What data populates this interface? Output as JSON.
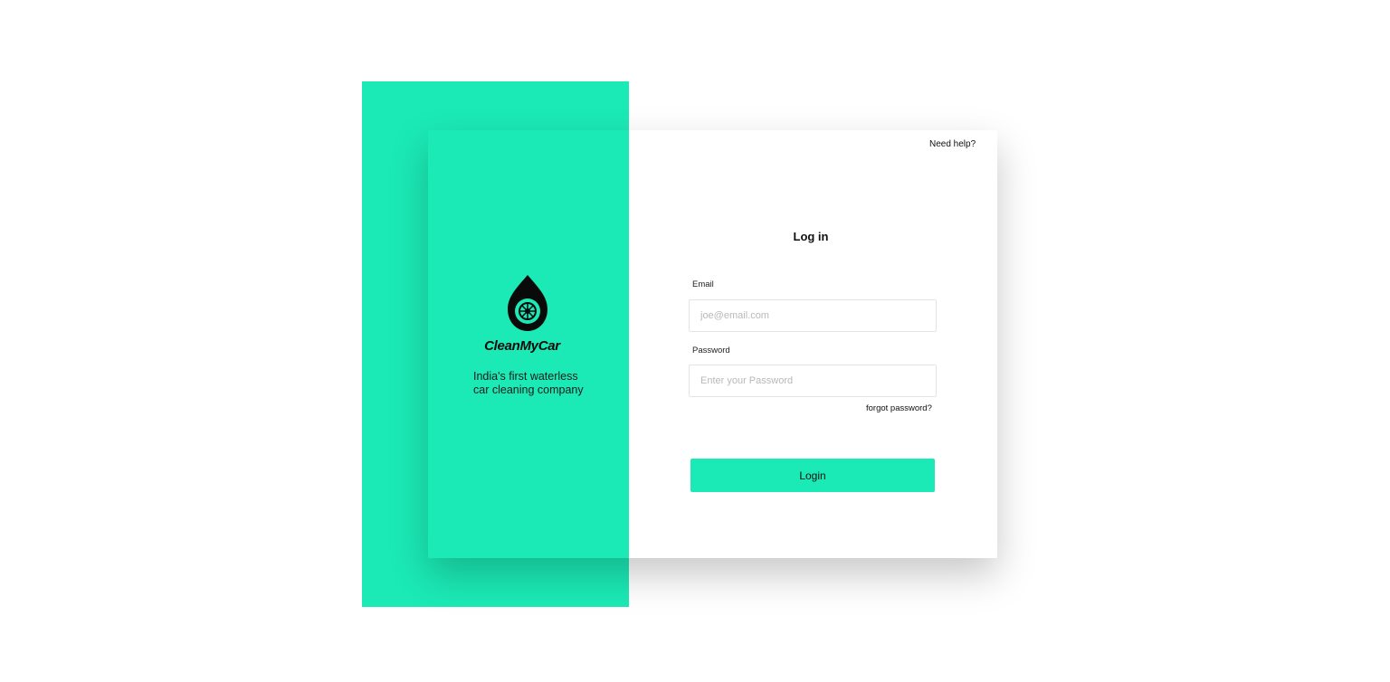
{
  "brand": {
    "name": "CleanMyCar",
    "tagline": "India's first waterless car cleaning company",
    "logo_icon": "water-drop-wheel-icon"
  },
  "header": {
    "help_link": "Need help?"
  },
  "form": {
    "title": "Log in",
    "email_label": "Email",
    "email_placeholder": "joe@email.com",
    "password_label": "Password",
    "password_placeholder": "Enter your Password",
    "forgot_link": "forgot password?",
    "login_label": "Login"
  },
  "colors": {
    "accent": "#1beab6",
    "background": "#ffffff",
    "text": "#111111"
  }
}
